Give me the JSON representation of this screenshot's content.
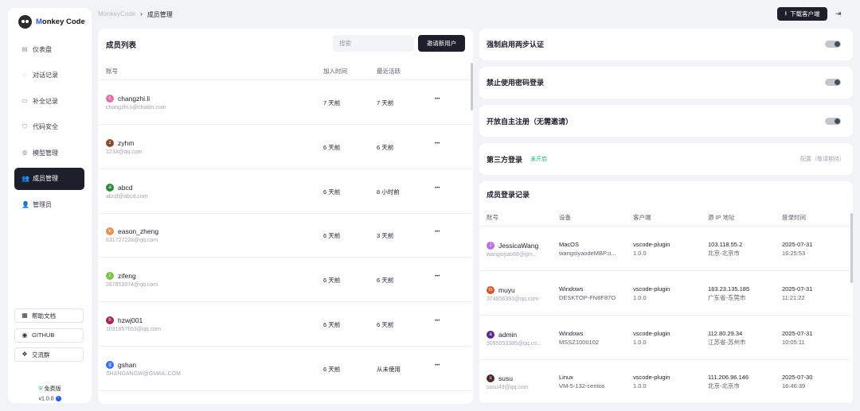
{
  "brand": {
    "prefix": "M",
    "rest": "onkey Code"
  },
  "nav": [
    {
      "label": "仪表盘",
      "icon": "dashboard-icon",
      "glyph": "▤"
    },
    {
      "label": "对话记录",
      "icon": "chat-icon",
      "glyph": "◌"
    },
    {
      "label": "补全记录",
      "icon": "completion-icon",
      "glyph": "▭"
    },
    {
      "label": "代码安全",
      "icon": "shield-icon",
      "glyph": "⛉"
    },
    {
      "label": "模型管理",
      "icon": "model-icon",
      "glyph": "◍"
    },
    {
      "label": "成员管理",
      "icon": "users-icon",
      "glyph": "👥"
    },
    {
      "label": "管理员",
      "icon": "admin-icon",
      "glyph": "👤"
    }
  ],
  "side_links": [
    {
      "label": "帮助文档",
      "icon": "doc-icon",
      "glyph": "▦"
    },
    {
      "label": "GITHUB",
      "icon": "github-icon",
      "glyph": "◉"
    },
    {
      "label": "交流群",
      "icon": "group-icon",
      "glyph": "❖"
    }
  ],
  "plan": {
    "label": "免费版",
    "version": "v1.0.0"
  },
  "breadcrumb": {
    "root": "MonkeyCode",
    "sep": "›",
    "current": "成员管理"
  },
  "header": {
    "download": "下载客户端"
  },
  "members": {
    "title": "成员列表",
    "search_placeholder": "搜索",
    "invite": "邀请新用户",
    "columns": {
      "account": "账号",
      "joined": "加入时间",
      "active": "最近活跃"
    },
    "rows": [
      {
        "initial": "c",
        "color": "#e26fb0",
        "name": "changzhi.li",
        "email": "changzhi.li@chaitin.com",
        "joined": "7 天前",
        "active": "7 天前"
      },
      {
        "initial": "z",
        "color": "#8a4a2e",
        "name": "zyhm",
        "email": "1234@qq.com",
        "joined": "6 天前",
        "active": "6 天前"
      },
      {
        "initial": "a",
        "color": "#2c8a3e",
        "name": "abcd",
        "email": "abcd@abcd.com",
        "joined": "6 天前",
        "active": "8 小时前"
      },
      {
        "initial": "e",
        "color": "#e2915a",
        "name": "eason_zheng",
        "email": "631727228@qq.com",
        "joined": "6 天前",
        "active": "3 天前"
      },
      {
        "initial": "z",
        "color": "#7cc24a",
        "name": "zifeng",
        "email": "287851074@qq.com",
        "joined": "6 天前",
        "active": "6 天前"
      },
      {
        "initial": "h",
        "color": "#a3245a",
        "name": "hzwj001",
        "email": "1031857653@qq.com",
        "joined": "6 天前",
        "active": "6 天前"
      },
      {
        "initial": "g",
        "color": "#3c6ee6",
        "name": "gshan",
        "email": "SHANGANGW@GMAIL.COM",
        "joined": "6 天前",
        "active": "从未使用"
      }
    ]
  },
  "settings": {
    "two_factor": "强制启用两步认证",
    "no_password": "禁止使用密码登录",
    "open_signup": "开放自主注册（无需邀请）",
    "third_party": "第三方登录",
    "third_party_status": "未开启",
    "configure": "配置（敬请期待）"
  },
  "login_log": {
    "title": "成员登录记录",
    "columns": {
      "account": "账号",
      "device": "设备",
      "client": "客户端",
      "ip": "源 IP 地址",
      "time": "登录时间"
    },
    "rows": [
      {
        "initial": "J",
        "color": "#b86fe0",
        "name": "JessicaWang",
        "email": "wangsiyao68@gm...",
        "os": "MacOS",
        "host": "wangsiyaodeMBP.u...",
        "client": "vscode-plugin",
        "client_ver": "1.0.0",
        "ip": "103.118.55.2",
        "location": "北京-北京市",
        "date": "2025-07-31",
        "time": "16:25:53"
      },
      {
        "initial": "m",
        "color": "#d4552e",
        "name": "muyu",
        "email": "374856393@qq.com",
        "os": "Windows",
        "host": "DESKTOP-FN8F87O",
        "client": "vscode-plugin",
        "client_ver": "1.0.0",
        "ip": "183.23.135.185",
        "location": "广东省-东莞市",
        "date": "2025-07-31",
        "time": "11:21:22"
      },
      {
        "initial": "a",
        "color": "#5a2a8a",
        "name": "admin",
        "email": "3095053385@qq.co...",
        "os": "Windows",
        "host": "MSSZ1000102",
        "client": "vscode-plugin",
        "client_ver": "1.0.0",
        "ip": "112.80.29.34",
        "location": "江苏省-苏州市",
        "date": "2025-07-31",
        "time": "10:05:11"
      },
      {
        "initial": "s",
        "color": "#4a2a2a",
        "name": "susu",
        "email": "susu43@qq.com",
        "os": "Linux",
        "host": "VM-5-132-centos",
        "client": "vscode-plugin",
        "client_ver": "1.0.0",
        "ip": "111.206.96.146",
        "location": "北京-北京市",
        "date": "2025-07-30",
        "time": "16:46:39"
      }
    ]
  }
}
